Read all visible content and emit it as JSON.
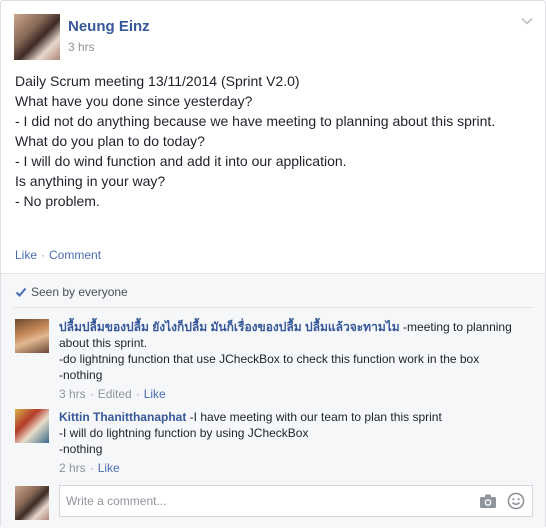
{
  "post": {
    "author": "Neung Einz",
    "time": "3 hrs",
    "lines": [
      "Daily Scrum meeting 13/11/2014 (Sprint V2.0)",
      "What have you done since yesterday?",
      "- I did not do anything because we have meeting to planning about this sprint.",
      "What do you plan to do today?",
      "- I will do wind function and add it into our application.",
      "Is anything in your way?",
      "- No problem."
    ],
    "actions": {
      "like": "Like",
      "separator": "·",
      "comment": "Comment"
    }
  },
  "seen": {
    "text": "Seen by everyone"
  },
  "comments": [
    {
      "author": "ปลื้มปลื้มของปลื้ม ยังไงก็ปลื้ม มันก็เรื่องของปลื้ม ปลื้มแล้วจะทามไม",
      "text": " -meeting to planning about this sprint.\n-do lightning function that use JCheckBox to check this function work in the box\n-nothing",
      "time": "3 hrs",
      "edited": "Edited",
      "like": "Like",
      "separator": "·"
    },
    {
      "author": "Kittin Thanitthanaphat",
      "text": " -I have meeting with our team to plan this sprint\n-I will do lightning function by using JCheckBox\n-nothing",
      "time": "2 hrs",
      "like": "Like",
      "separator": "·"
    }
  ],
  "composer": {
    "placeholder": "Write a comment..."
  },
  "icons": {
    "chevron": "chevron-down-icon",
    "check": "check-icon",
    "camera": "camera-icon",
    "smiley": "smiley-icon"
  },
  "colors": {
    "name": "#365899",
    "link": "#4b6cb1",
    "meta": "#90949c",
    "feedback_bg": "#f6f7f9"
  }
}
